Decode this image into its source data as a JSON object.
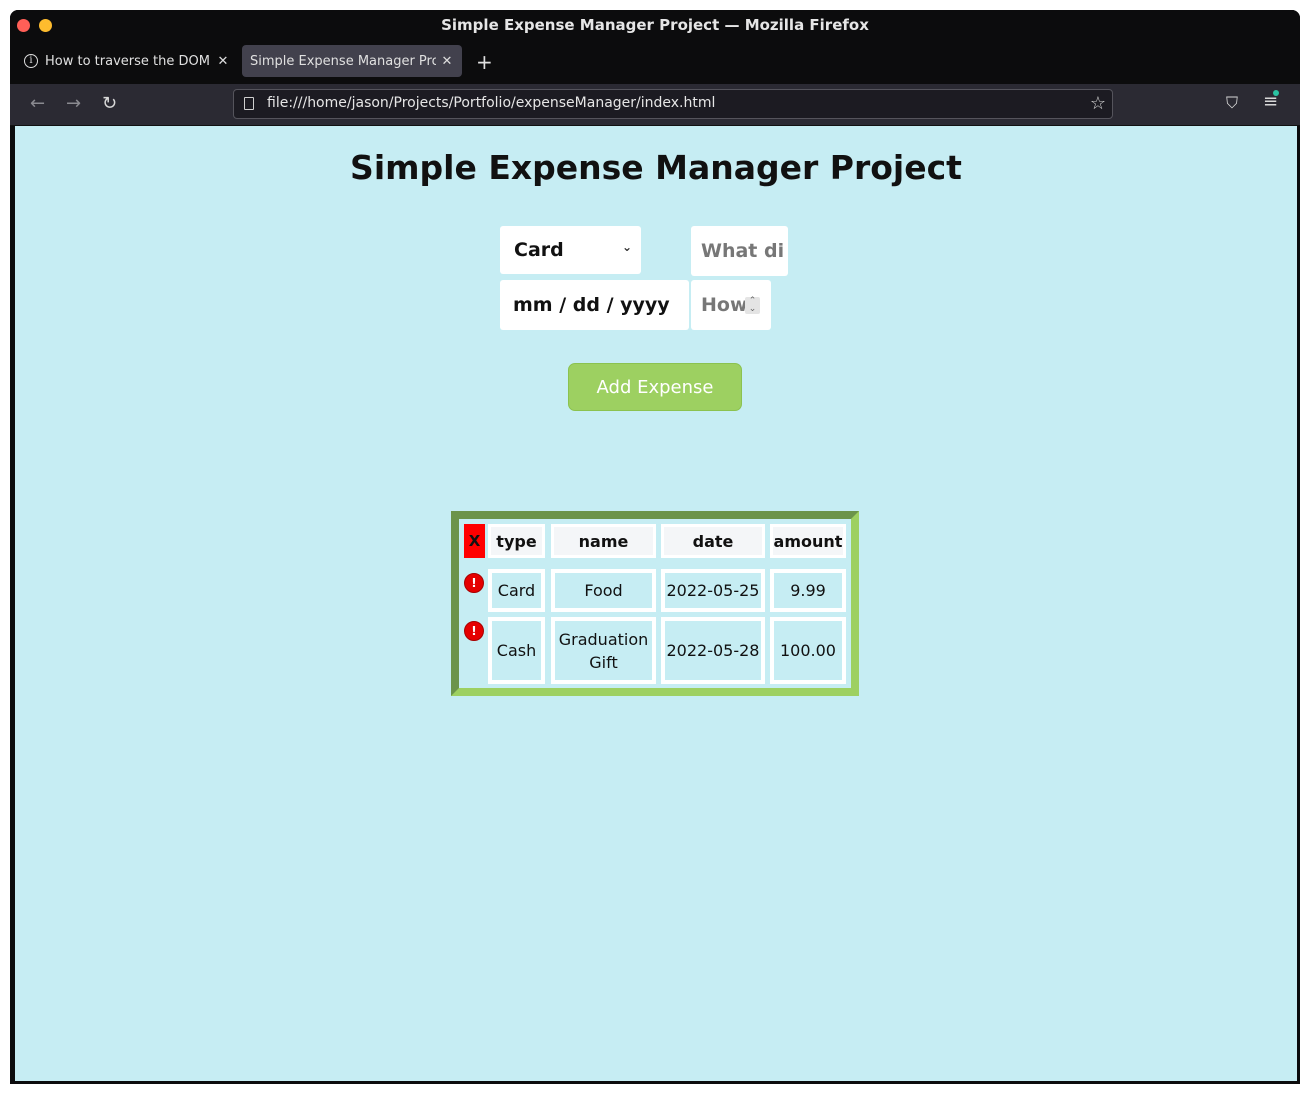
{
  "browser": {
    "window_title": "Simple Expense Manager Project — Mozilla Firefox",
    "tabs": [
      {
        "label": "How to traverse the DOM in",
        "active": false
      },
      {
        "label": "Simple Expense Manager Project",
        "active": true
      }
    ],
    "url": "file:///home/jason/Projects/Portfolio/expenseManager/index.html"
  },
  "page": {
    "title": "Simple Expense Manager Project",
    "form": {
      "type_value": "Card",
      "name_placeholder": "What di",
      "date_value": "mm / dd / yyyy",
      "amount_placeholder": "How",
      "add_button": "Add Expense"
    },
    "table": {
      "delete_all_label": "X",
      "row_delete_label": "!",
      "headers": [
        "type",
        "name",
        "date",
        "amount"
      ],
      "rows": [
        [
          "Card",
          "Food",
          "2022-05-25",
          "9.99"
        ],
        [
          "Cash",
          "Graduation Gift",
          "2022-05-28",
          "100.00"
        ]
      ]
    }
  },
  "colors": {
    "page_background": "#c6edf3",
    "button_green": "#9dd061",
    "frame_dark_green": "#6b944a",
    "delete_red": "#ff0000"
  }
}
